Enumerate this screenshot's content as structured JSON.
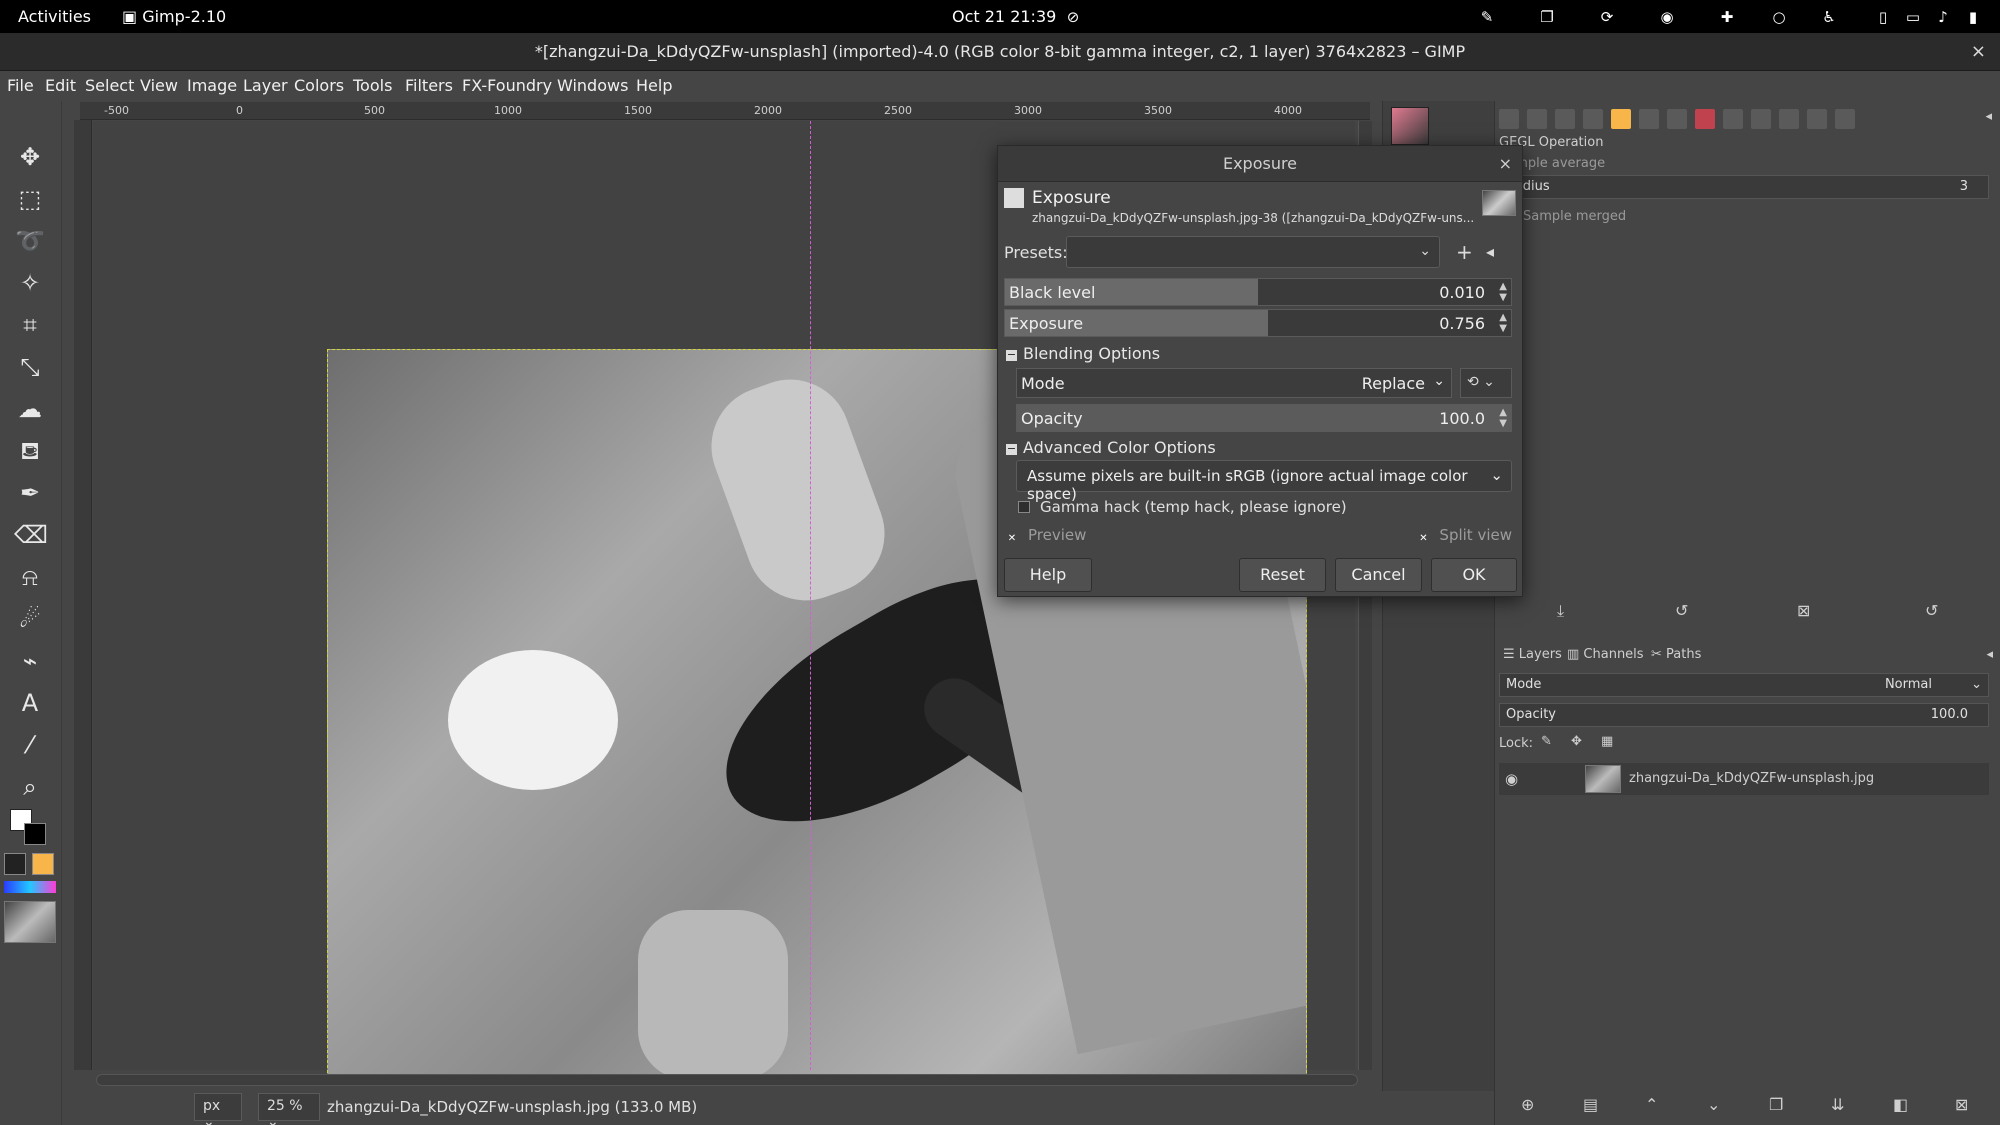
{
  "topbar": {
    "activities": "Activities",
    "app": "Gimp-2.10",
    "clock": "Oct 21  21:39"
  },
  "window": {
    "title": "*[zhangzui-Da_kDdyQZFw-unsplash] (imported)-4.0 (RGB color 8-bit gamma integer, c2, 1 layer) 3764x2823 – GIMP",
    "close": "×"
  },
  "menu": [
    "File",
    "Edit",
    "Select",
    "View",
    "Image",
    "Layer",
    "Colors",
    "Tools",
    "Filters",
    "FX-Foundry",
    "Windows",
    "Help"
  ],
  "ruler": [
    "-500",
    "0",
    "500",
    "1000",
    "1500",
    "2000",
    "2500",
    "3000",
    "3500",
    "4000"
  ],
  "statusbar": {
    "unit": "px",
    "zoom": "25 %",
    "file_info": "zhangzui-Da_kDdyQZFw-unsplash.jpg (133.0 MB)"
  },
  "dialog": {
    "title": "Exposure",
    "heading": "Exposure",
    "subheading": "zhangzui-Da_kDdyQZFw-unsplash.jpg-38 ([zhangzui-Da_kDdyQZFw-uns...",
    "presets_label": "Presets:",
    "black_level_label": "Black level",
    "black_level_value": "0.010",
    "black_level_fill": 0.5,
    "exposure_label": "Exposure",
    "exposure_value": "0.756",
    "exposure_fill": 0.52,
    "blending_header": "Blending Options",
    "mode_label": "Mode",
    "mode_value": "Replace",
    "opacity_label": "Opacity",
    "opacity_value": "100.0",
    "advanced_header": "Advanced Color Options",
    "color_space": "Assume pixels are built-in sRGB (ignore actual image color space)",
    "gamma_hack": "Gamma hack (temp hack, please ignore)",
    "preview": "Preview",
    "split_view": "Split view",
    "buttons": {
      "help": "Help",
      "reset": "Reset",
      "cancel": "Cancel",
      "ok": "OK"
    }
  },
  "tool_options": {
    "gegl": "GEGL Operation",
    "sample_average": "Sample average",
    "radius_label": "Radius",
    "radius_value": "3",
    "sample_merged": "Sample merged"
  },
  "layers_panel": {
    "tabs": [
      "Layers",
      "Channels",
      "Paths"
    ],
    "mode_label": "Mode",
    "mode_value": "Normal",
    "opacity_label": "Opacity",
    "opacity_value": "100.0",
    "lock_label": "Lock:",
    "layer_name": "zhangzui-Da_kDdyQZFw-unsplash.jpg"
  }
}
